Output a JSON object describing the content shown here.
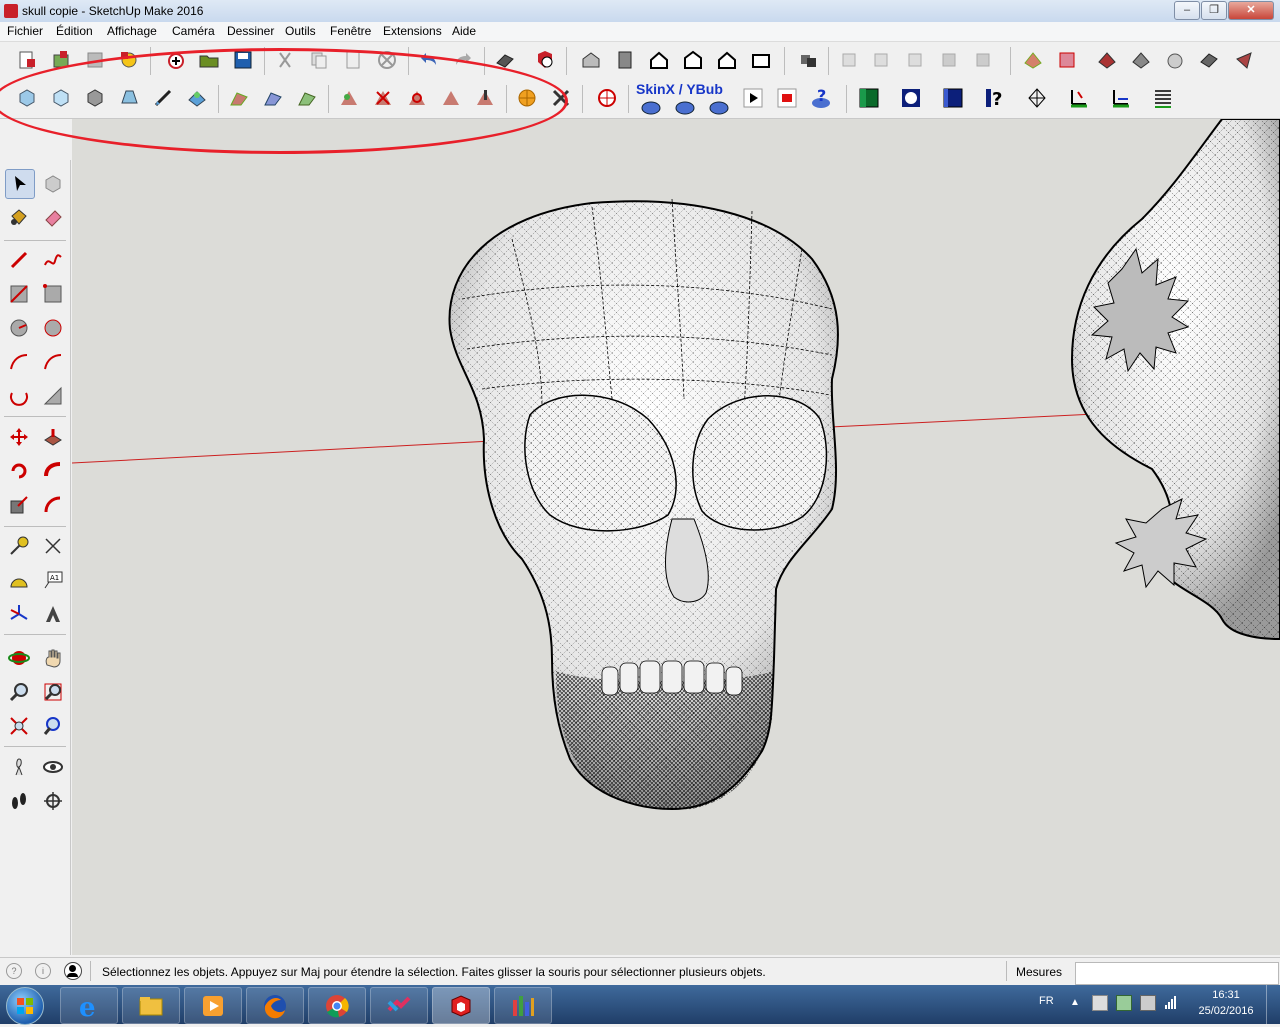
{
  "window": {
    "title": "skull copie - SketchUp Make 2016",
    "controls": [
      "minimize",
      "maximize",
      "close"
    ]
  },
  "menu": {
    "items": [
      "Fichier",
      "Édition",
      "Affichage",
      "Caméra",
      "Dessiner",
      "Outils",
      "Fenêtre",
      "Extensions",
      "Aide"
    ]
  },
  "toolbars": {
    "skinx_label": "SkinX / YBub",
    "row1_icons": [
      "new-icon",
      "open-icon",
      "save-icon",
      "print-icon",
      "add-component-icon",
      "open-folder-icon",
      "save-disk-icon",
      "cut-icon",
      "copy-icon",
      "paste-icon",
      "erase-icon",
      "undo-icon",
      "redo-icon",
      "print2-icon",
      "model-info-icon",
      "iso-icon",
      "top-icon",
      "front-icon",
      "right-icon",
      "back-icon",
      "left-icon",
      "section-icon",
      "xray-icon",
      "wireframe-icon",
      "hidden-line-icon",
      "shaded-icon",
      "shaded-texture-icon",
      "monochrome-icon",
      "texture-icon",
      "grid-icon",
      "sandbox-icon",
      "terrain-icon",
      "stamp-icon",
      "drape-icon",
      "flip-icon"
    ],
    "row2_icons": [
      "view-iso-icon",
      "view-top-icon",
      "view-front-icon",
      "view-right-icon",
      "view-section-icon",
      "view-render-icon",
      "fredo-1-icon",
      "fredo-2-icon",
      "fredo-3-icon",
      "fredo-4-icon",
      "fredo-5-icon",
      "fredo-6-icon",
      "fredo-7-icon",
      "fredo-8-icon",
      "sun-icon",
      "tools-icon",
      "globe-icon",
      "skinx-1-icon",
      "skinx-2-icon",
      "skinx-3-icon",
      "play-icon",
      "stop-icon",
      "help-icon",
      "green-block-icon",
      "circle-icon",
      "blue-block-icon",
      "question-icon",
      "mesh-icon",
      "axes-icon",
      "dims-icon",
      "lines-icon"
    ]
  },
  "left_tools": [
    "select-arrow-icon",
    "component-icon",
    "paint-bucket-icon",
    "eraser-icon",
    "pencil-icon",
    "freehand-icon",
    "rectangle-icon",
    "rotated-rect-icon",
    "circle-icon",
    "polygon-icon",
    "arc-icon",
    "arc-2-icon",
    "arc-3-icon",
    "pie-icon",
    "move-icon",
    "push-pull-icon",
    "rotate-icon",
    "follow-me-icon",
    "scale-icon",
    "offset-icon",
    "tape-measure-icon",
    "dimension-icon",
    "protractor-icon",
    "text-icon",
    "axes-icon",
    "3d-text-icon",
    "orbit-icon",
    "pan-icon",
    "zoom-icon",
    "zoom-window-icon",
    "zoom-extents-icon",
    "previous-icon",
    "position-camera-icon",
    "look-around-icon",
    "walk-icon",
    "section-plane-icon"
  ],
  "status": {
    "text": "Sélectionnez les objets. Appuyez sur Maj pour étendre la sélection. Faites glisser la souris pour sélectionner plusieurs objets.",
    "measures_label": "Mesures",
    "measures_value": ""
  },
  "taskbar": {
    "apps": [
      "start-orb-icon",
      "ie-icon",
      "explorer-icon",
      "media-player-icon",
      "firefox-icon",
      "chrome-icon",
      "app-icon",
      "sketchup-icon",
      "chart-app-icon"
    ],
    "language": "FR",
    "time": "16:31",
    "date": "25/02/2016"
  },
  "colors": {
    "accent_red": "#e8202a",
    "axis_red": "#cc2020",
    "viewport_bg": "#dcdcd8"
  }
}
